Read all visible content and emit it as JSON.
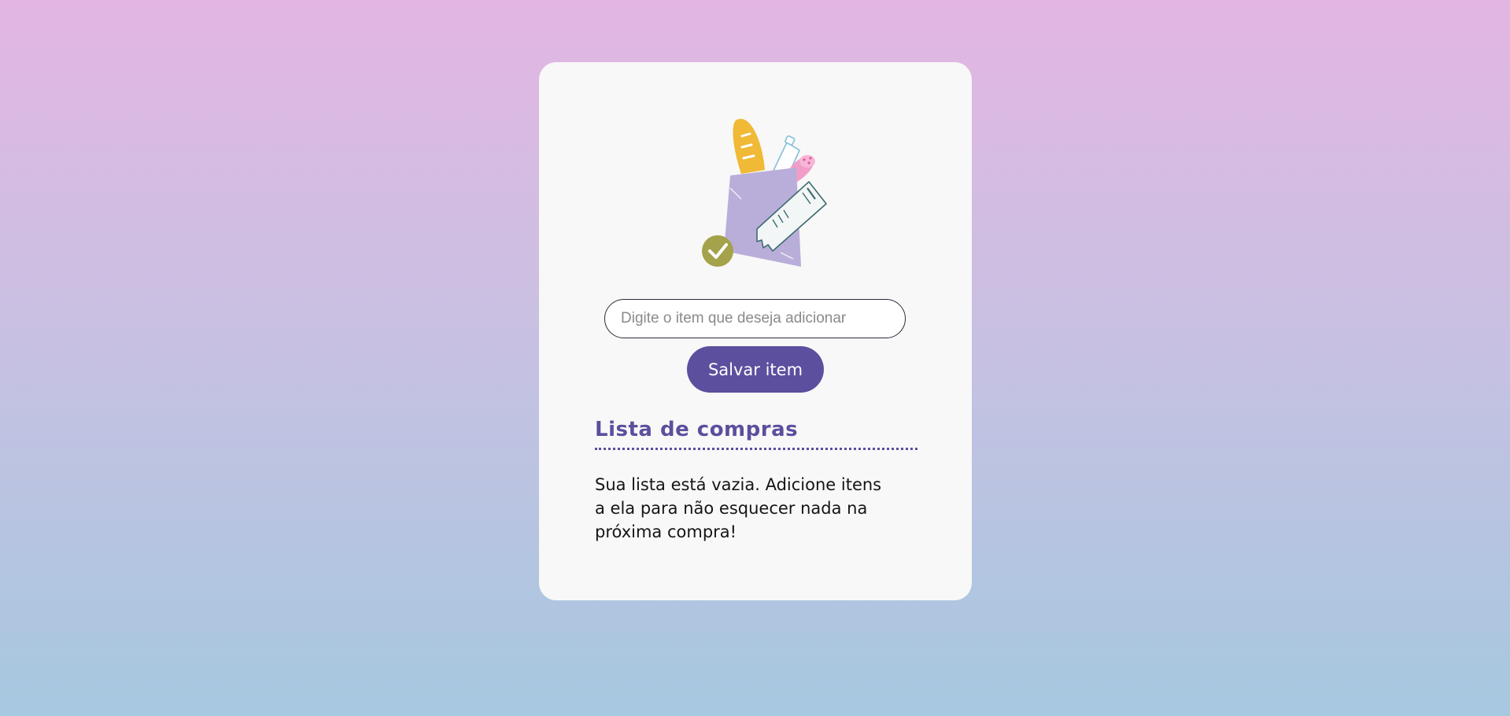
{
  "form": {
    "input_placeholder": "Digite o item que deseja adicionar",
    "input_value": "",
    "save_label": "Salvar item"
  },
  "list": {
    "title": "Lista de compras",
    "empty_message": "Sua lista está vazia. Adicione itens a ela para não esquecer nada na próxima compra!"
  },
  "illustration": {
    "icon": "grocery-bag-icon"
  },
  "colors": {
    "accent": "#5b4f9e",
    "card_background": "#f8f8f8",
    "gradient_top": "#e3b6e2",
    "gradient_bottom": "#a6c8e0",
    "check_badge": "#a4a24a"
  }
}
